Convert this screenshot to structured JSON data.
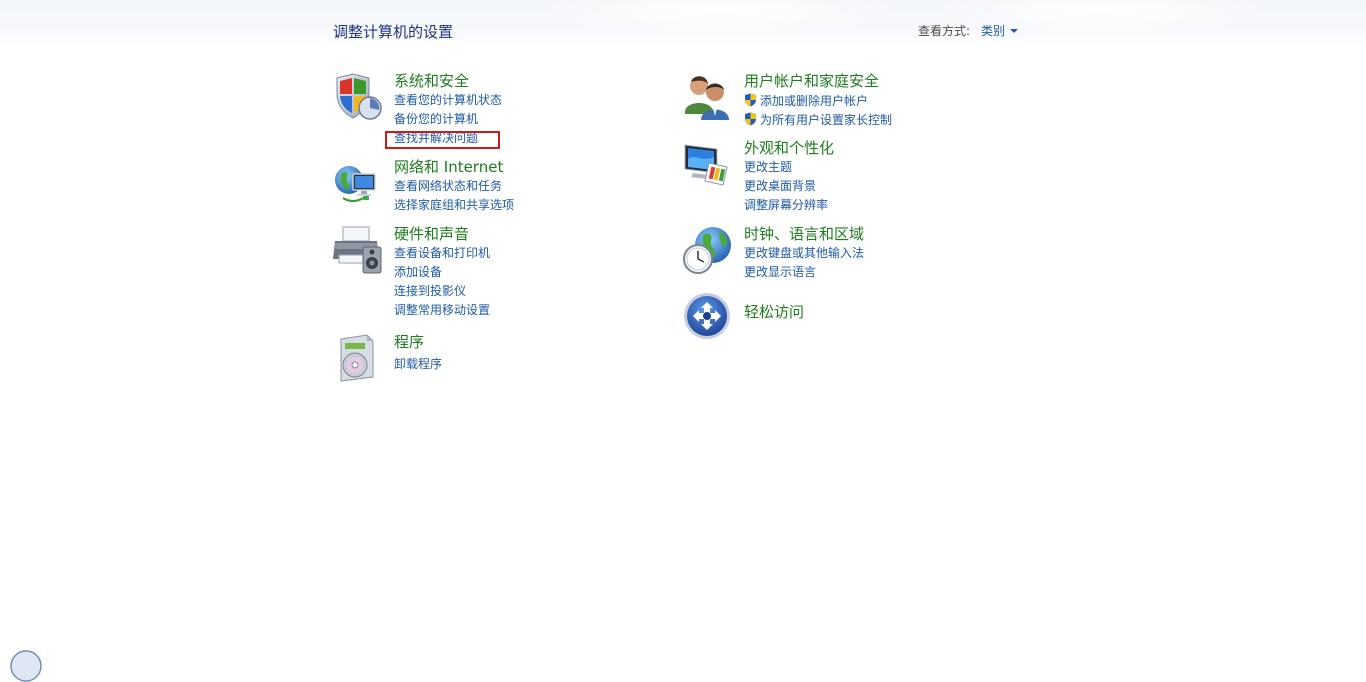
{
  "header": {
    "page_title": "调整计算机的设置",
    "view_by_label": "查看方式:",
    "view_by_value": "类别"
  },
  "categories": {
    "system_security": {
      "title": "系统和安全",
      "icon": "shield-icon",
      "links": [
        "查看您的计算机状态",
        "备份您的计算机",
        "查找并解决问题"
      ]
    },
    "network_internet": {
      "title": "网络和 Internet",
      "icon": "network-globe-icon",
      "links": [
        "查看网络状态和任务",
        "选择家庭组和共享选项"
      ]
    },
    "hardware_sound": {
      "title": "硬件和声音",
      "icon": "printer-speaker-icon",
      "links": [
        "查看设备和打印机",
        "添加设备",
        "连接到投影仪",
        "调整常用移动设置"
      ]
    },
    "programs": {
      "title": "程序",
      "icon": "programs-disc-icon",
      "links": [
        "卸载程序"
      ]
    },
    "user_accounts": {
      "title": "用户帐户和家庭安全",
      "icon": "users-icon",
      "links": [
        "添加或删除用户帐户",
        "为所有用户设置家长控制"
      ]
    },
    "appearance": {
      "title": "外观和个性化",
      "icon": "monitor-palette-icon",
      "links": [
        "更改主题",
        "更改桌面背景",
        "调整屏幕分辨率"
      ]
    },
    "clock_region": {
      "title": "时钟、语言和区域",
      "icon": "clock-globe-icon",
      "links": [
        "更改键盘或其他输入法",
        "更改显示语言"
      ]
    },
    "ease_access": {
      "title": "轻松访问",
      "icon": "ease-of-access-icon",
      "links": []
    }
  },
  "colors": {
    "category_title": "#1d7d1d",
    "link": "#1e5aa8",
    "page_title": "#1e3287",
    "highlight": "#d01a1a"
  }
}
